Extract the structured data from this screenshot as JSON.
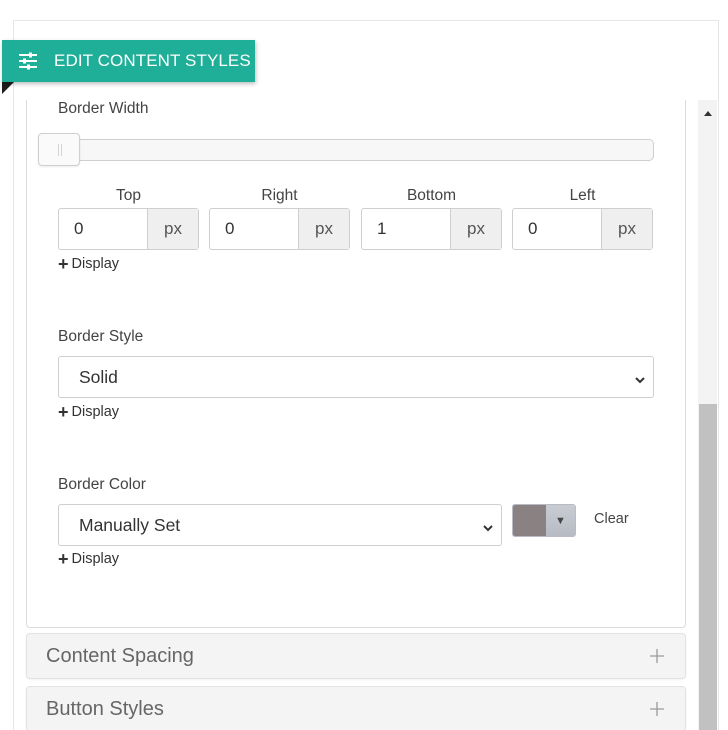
{
  "header": {
    "title": "EDIT CONTENT STYLES",
    "icon": "sliders-icon"
  },
  "border_width": {
    "label": "Border Width",
    "slider_value": 0,
    "sides": [
      {
        "label": "Top",
        "value": "0",
        "unit": "px"
      },
      {
        "label": "Right",
        "value": "0",
        "unit": "px"
      },
      {
        "label": "Bottom",
        "value": "1",
        "unit": "px"
      },
      {
        "label": "Left",
        "value": "0",
        "unit": "px"
      }
    ],
    "display_link": "Display"
  },
  "border_style": {
    "label": "Border Style",
    "selected": "Solid",
    "display_link": "Display"
  },
  "border_color": {
    "label": "Border Color",
    "selected": "Manually Set",
    "swatch_color": "#8a8282",
    "clear_label": "Clear",
    "display_link": "Display"
  },
  "sections": [
    {
      "label": "Content Spacing"
    },
    {
      "label": "Button Styles"
    }
  ],
  "colors": {
    "accent": "#1fae97"
  }
}
